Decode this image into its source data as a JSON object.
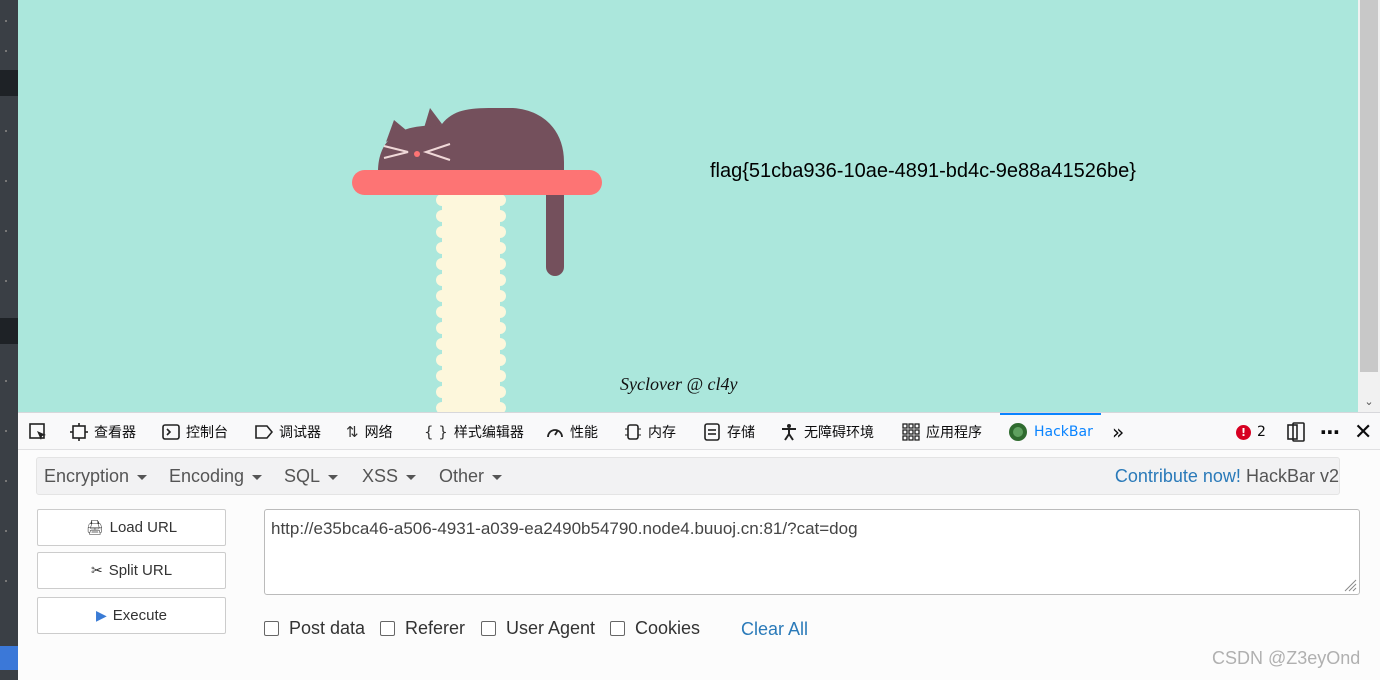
{
  "page": {
    "flag": "flag{51cba936-10ae-4891-bd4c-9e88a41526be}",
    "signature": "Syclover @ cl4y",
    "background_color": "#abe7dc"
  },
  "devtools": {
    "tabs": [
      {
        "label": "",
        "icon": "element-picker-icon"
      },
      {
        "label": "查看器",
        "icon": "inspector-icon"
      },
      {
        "label": "控制台",
        "icon": "console-icon"
      },
      {
        "label": "调试器",
        "icon": "debugger-icon"
      },
      {
        "label": "网络",
        "icon": "network-icon"
      },
      {
        "label": "样式编辑器",
        "icon": "style-editor-icon"
      },
      {
        "label": "性能",
        "icon": "performance-icon"
      },
      {
        "label": "内存",
        "icon": "memory-icon"
      },
      {
        "label": "存储",
        "icon": "storage-icon"
      },
      {
        "label": "无障碍环境",
        "icon": "accessibility-icon"
      },
      {
        "label": "应用程序",
        "icon": "application-icon"
      },
      {
        "label": "HackBar",
        "icon": "hackbar-icon",
        "active": true
      }
    ],
    "error_count": "2",
    "accent_color": "#0a84ff"
  },
  "hackbar": {
    "menus": [
      "Encryption",
      "Encoding",
      "SQL",
      "XSS",
      "Other"
    ],
    "contribute_link": "Contribute now!",
    "version": "HackBar v2",
    "buttons": {
      "load": "Load URL",
      "split": "Split URL",
      "execute": "Execute"
    },
    "url": "http://e35bca46-a506-4931-a039-ea2490b54790.node4.buuoj.cn:81/?cat=dog",
    "options": [
      "Post data",
      "Referer",
      "User Agent",
      "Cookies"
    ],
    "clear_all": "Clear All"
  },
  "watermark": "CSDN @Z3eyOnd"
}
